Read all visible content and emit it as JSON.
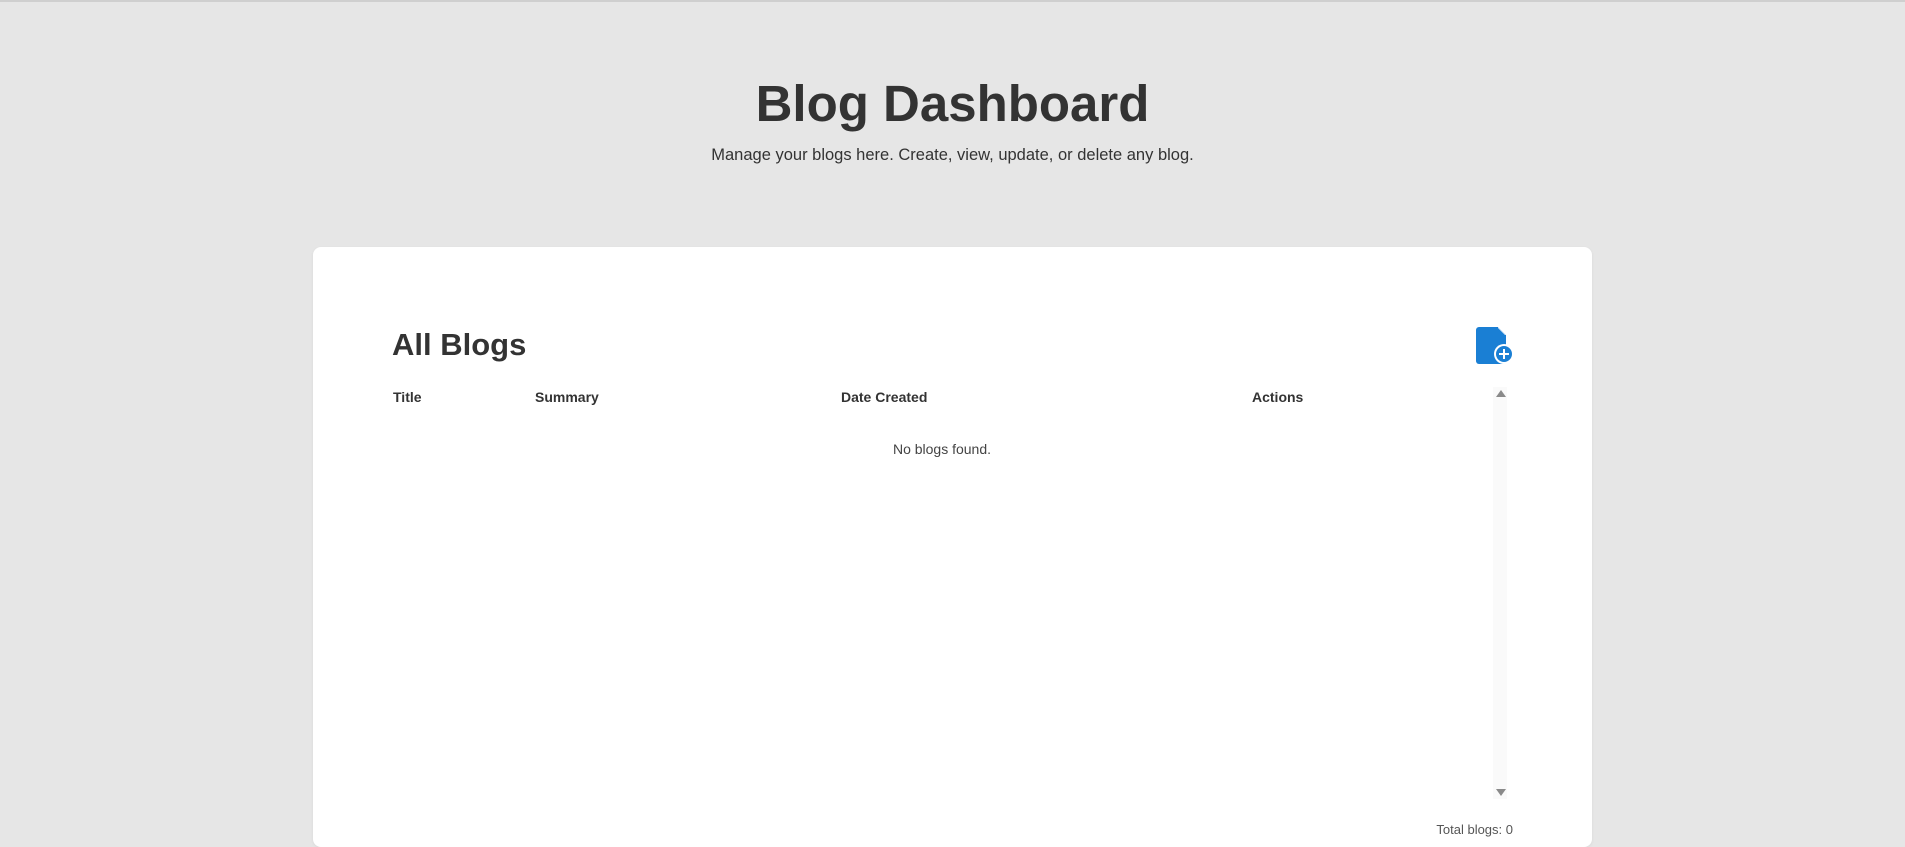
{
  "header": {
    "title": "Blog Dashboard",
    "subtitle": "Manage your blogs here. Create, view, update, or delete any blog."
  },
  "blogs": {
    "title": "All Blogs",
    "add_icon": "add-document-icon",
    "columns": [
      "Title",
      "Summary",
      "Date Created",
      "Actions"
    ],
    "empty_message": "No blogs found.",
    "rows": [],
    "footer_total": "Total blogs: 0"
  },
  "colors": {
    "background": "#e6e6e6",
    "card": "#ffffff",
    "accent": "#1a7fd4",
    "text": "#333333"
  }
}
